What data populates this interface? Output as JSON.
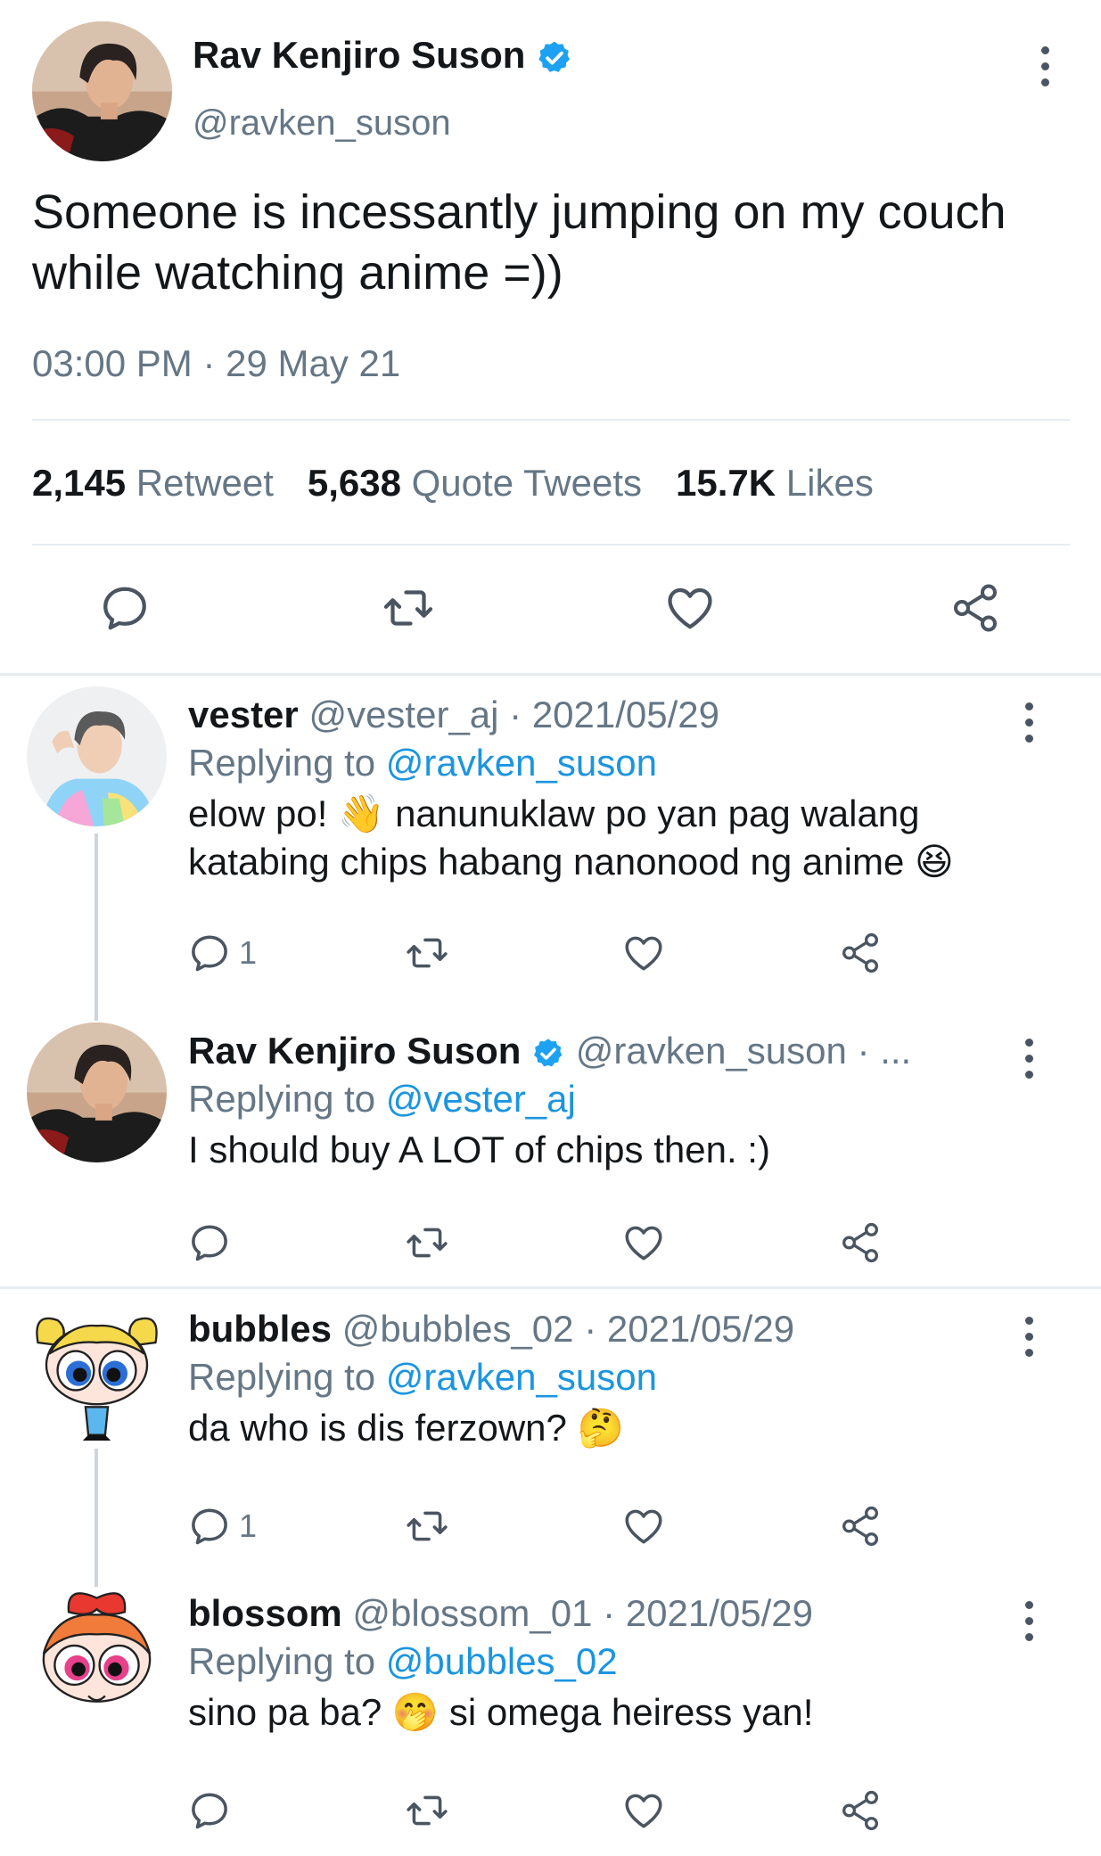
{
  "main_tweet": {
    "author_name": "Rav Kenjiro Suson",
    "author_handle": "@ravken_suson",
    "text": "Someone is incessantly jumping on my couch while watching anime =))",
    "time": "03:00 PM · 29 May 21",
    "stats": {
      "retweets_count": "2,145",
      "retweets_label": "Retweet",
      "quotes_count": "5,638",
      "quotes_label": "Quote Tweets",
      "likes_count": "15.7K",
      "likes_label": "Likes"
    }
  },
  "replies": [
    {
      "name": "vester",
      "handle": "@vester_aj · 2021/05/29",
      "replying_prefix": "Replying to ",
      "replying_to": "@ravken_suson",
      "text_a": "elow po! ",
      "text_b": " nanunuklaw po yan pag walang katabing chips habang nanonood ng anime ",
      "reply_count": "1",
      "emojis": [
        "waving-hand-emoji",
        "grinning-squinting-face-emoji"
      ]
    },
    {
      "name": "Rav Kenjiro Suson",
      "handle": "@ravken_suson · ...",
      "replying_prefix": "Replying to ",
      "replying_to": "@vester_aj",
      "text": "I should buy A LOT of chips then. :)",
      "reply_count": ""
    },
    {
      "name": "bubbles",
      "handle": "@bubbles_02 · 2021/05/29",
      "replying_prefix": "Replying to ",
      "replying_to": "@ravken_suson",
      "text": "da who is dis ferzown? ",
      "reply_count": "1",
      "emojis": [
        "thinking-face-emoji"
      ]
    },
    {
      "name": "blossom",
      "handle": "@blossom_01 · 2021/05/29",
      "replying_prefix": "Replying to ",
      "replying_to": "@bubbles_02",
      "text_a": "sino pa ba? ",
      "text_b": " si omega heiress yan!",
      "reply_count": "",
      "emojis": [
        "face-with-hand-over-mouth-emoji"
      ]
    }
  ],
  "colors": {
    "text": "#14171a",
    "secondary": "#657786",
    "accent": "#1b95e0",
    "divider": "#e6ecf0",
    "thread_line": "#ccd6dd"
  },
  "icons": [
    "reply-icon",
    "retweet-icon",
    "like-icon",
    "share-icon",
    "more-icon",
    "verified-badge-icon"
  ]
}
